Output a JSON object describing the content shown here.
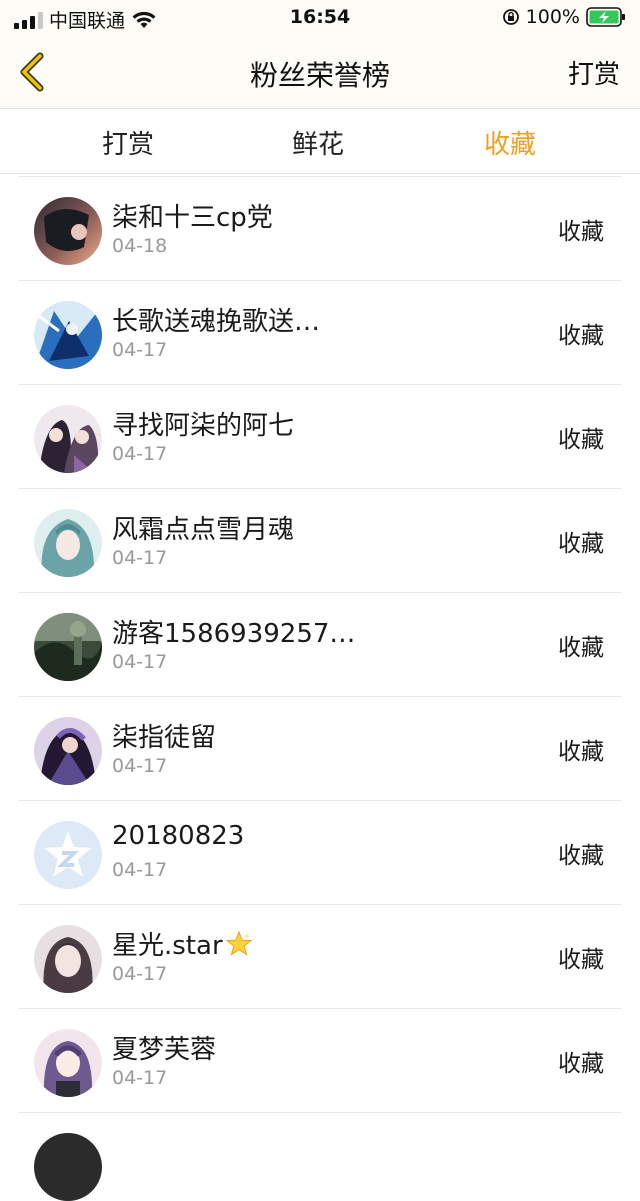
{
  "status": {
    "carrier": "中国联通",
    "time": "16:54",
    "battery_pct": "100%"
  },
  "nav": {
    "title": "粉丝荣誉榜",
    "right_label": "打赏"
  },
  "tabs": [
    "打赏",
    "鲜花",
    "收藏"
  ],
  "active_tab": "收藏",
  "accent_color": "#f0a020",
  "rows": [
    {
      "name": "柒和十三cp党",
      "date": "04-18",
      "type": "收藏",
      "avatar": "art-dark-warm"
    },
    {
      "name": "长歌送魂挽歌送…",
      "date": "04-17",
      "type": "收藏",
      "avatar": "art-blue"
    },
    {
      "name": "寻找阿柒的阿七",
      "date": "04-17",
      "type": "收藏",
      "avatar": "art-couple"
    },
    {
      "name": "风霜点点雪月魂",
      "date": "04-17",
      "type": "收藏",
      "avatar": "art-teal-hair"
    },
    {
      "name": "游客1586939257…",
      "date": "04-17",
      "type": "收藏",
      "avatar": "photo-forest"
    },
    {
      "name": "柒指徒留",
      "date": "04-17",
      "type": "收藏",
      "avatar": "art-purple"
    },
    {
      "name": "20180823",
      "date": "04-17",
      "type": "收藏",
      "avatar": "qq-default"
    },
    {
      "name": "星光.star",
      "date": "04-17",
      "type": "收藏",
      "avatar": "art-girl",
      "emoji": "star-icon"
    },
    {
      "name": "夏梦芙蓉",
      "date": "04-17",
      "type": "收藏",
      "avatar": "art-purple-girl"
    }
  ]
}
